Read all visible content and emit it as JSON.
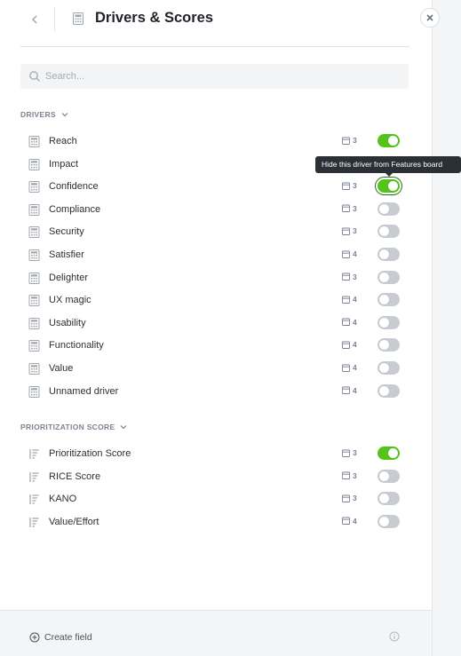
{
  "header": {
    "title": "Drivers & Scores",
    "back_icon": "chevron-left-icon",
    "title_icon": "calculator-icon",
    "close_icon": "close-icon"
  },
  "search": {
    "placeholder": "Search..."
  },
  "colors": {
    "toggle_on": "#52c41a",
    "toggle_off": "#c8ccd2",
    "tooltip_bg": "#2b2f36"
  },
  "drivers": {
    "label": "DRIVERS",
    "items": [
      {
        "label": "Reach",
        "count": "3",
        "on": true
      },
      {
        "label": "Impact",
        "count": "",
        "on": false
      },
      {
        "label": "Confidence",
        "count": "3",
        "on": true
      },
      {
        "label": "Compliance",
        "count": "3",
        "on": false
      },
      {
        "label": "Security",
        "count": "3",
        "on": false
      },
      {
        "label": "Satisfier",
        "count": "4",
        "on": false
      },
      {
        "label": "Delighter",
        "count": "3",
        "on": false
      },
      {
        "label": "UX magic",
        "count": "4",
        "on": false
      },
      {
        "label": "Usability",
        "count": "4",
        "on": false
      },
      {
        "label": "Functionality",
        "count": "4",
        "on": false
      },
      {
        "label": "Value",
        "count": "4",
        "on": false
      },
      {
        "label": "Unnamed driver",
        "count": "4",
        "on": false
      }
    ]
  },
  "tooltip": {
    "text": "Hide this driver from Features board"
  },
  "scores": {
    "label": "PRIORITIZATION SCORE",
    "items": [
      {
        "label": "Prioritization Score",
        "count": "3",
        "on": true
      },
      {
        "label": "RICE Score",
        "count": "3",
        "on": false
      },
      {
        "label": "KANO",
        "count": "3",
        "on": false
      },
      {
        "label": "Value/Effort",
        "count": "4",
        "on": false
      }
    ]
  },
  "footer": {
    "create_label": "Create field",
    "create_icon": "plus-circle-icon",
    "info_icon": "info-icon"
  }
}
